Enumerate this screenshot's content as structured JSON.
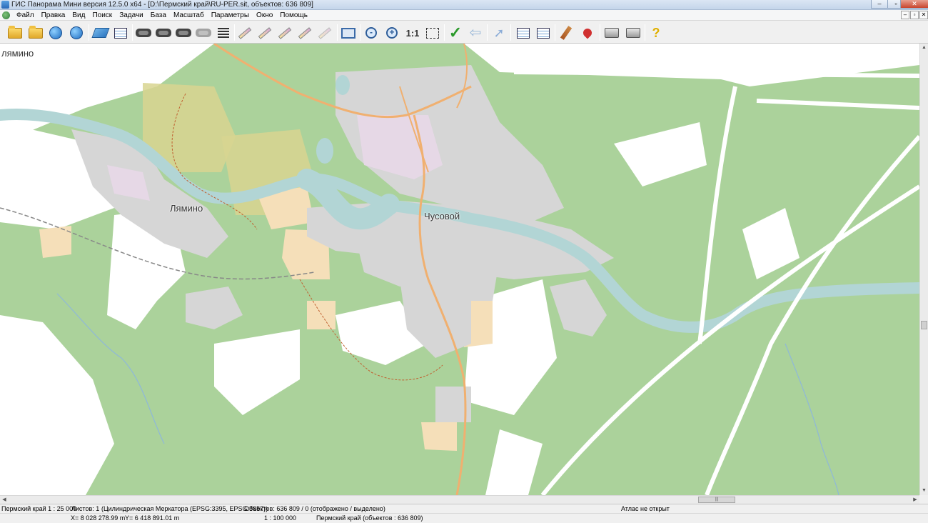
{
  "window": {
    "title": "ГИС Панорама Мини версия 12.5.0 x64 - [D:\\Пермский край\\RU-PER.sit, объектов: 636 809]",
    "minimize": "–",
    "maximize": "▫",
    "close": "✕"
  },
  "menu": {
    "items": [
      "Файл",
      "Правка",
      "Вид",
      "Поиск",
      "Задачи",
      "База",
      "Масштаб",
      "Параметры",
      "Окно",
      "Помощь"
    ],
    "mdi_min": "–",
    "mdi_restore": "▫",
    "mdi_close": "✕"
  },
  "toolbar": {
    "scale_1_1": "1:1"
  },
  "map": {
    "labels": {
      "lyamino_partial": "лямино",
      "lyamino": "Лямино",
      "chusovoy": "Чусовой"
    },
    "colors": {
      "forest": "#abd29b",
      "water": "#b2d5d5",
      "urban": "#d6d6d6",
      "residential": "#e6d8e6",
      "field": "#d8d590",
      "farmland": "#f5dfb9",
      "road": "#f0b070",
      "rail": "#888888"
    }
  },
  "status": {
    "region_scale": "Пермский край  1 : 25 000",
    "sheets": "Листов: 1",
    "projection": "(Цилиндрическая Меркатора (EPSG:3395, EPSG:3857))",
    "objects": "Объектов: 636 809 / 0 (отображено / выделено)",
    "atlas": "Атлас не открыт",
    "x_coord": "X= 8 028 278.99 m",
    "y_coord": "Y= 6 418 891.01 m",
    "scale2": "1 : 100 000",
    "region_objects": "Пермский край   (объектов : 636 809)"
  }
}
